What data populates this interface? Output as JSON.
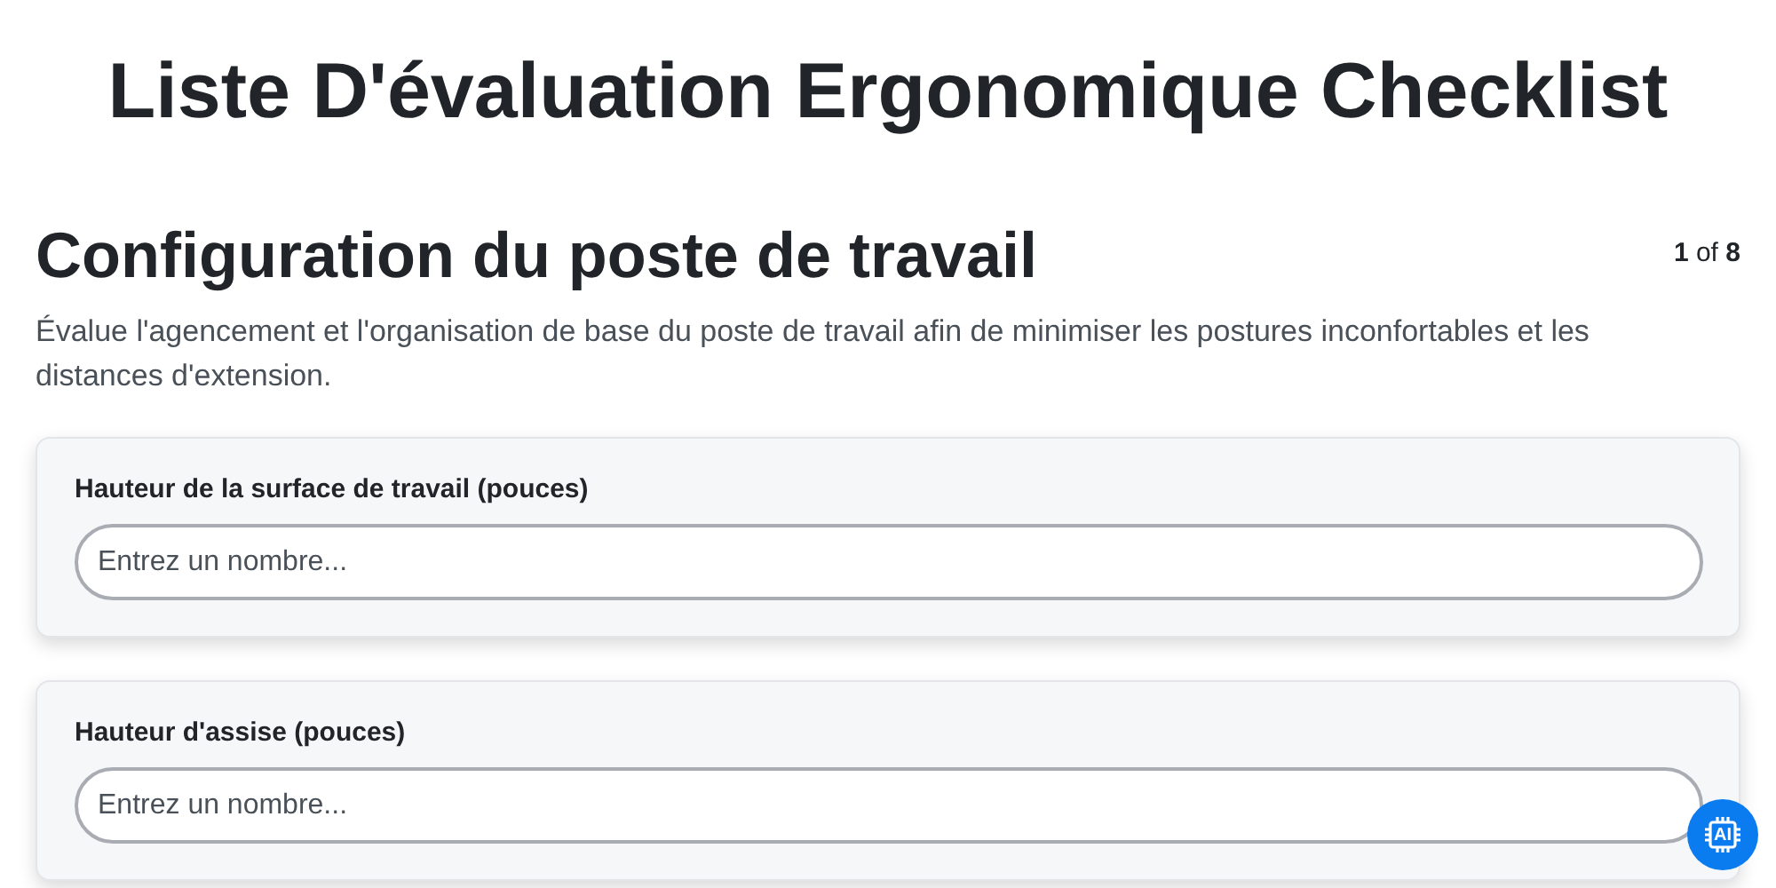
{
  "title": "Liste D'évaluation Ergonomique Checklist",
  "section": {
    "heading": "Configuration du poste de travail",
    "progress": "**1** of **8**",
    "description": "Évalue l'agencement et l'organisation de base du poste de travail afin de minimiser les postures inconfortables et les distances d'extension."
  },
  "questions": [
    {
      "label": "Hauteur de la surface de travail (pouces)",
      "placeholder": "Entrez un nombre..."
    },
    {
      "label": "Hauteur d'assise (pouces)",
      "placeholder": "Entrez un nombre..."
    }
  ],
  "ai_button": {
    "label": "AI"
  }
}
